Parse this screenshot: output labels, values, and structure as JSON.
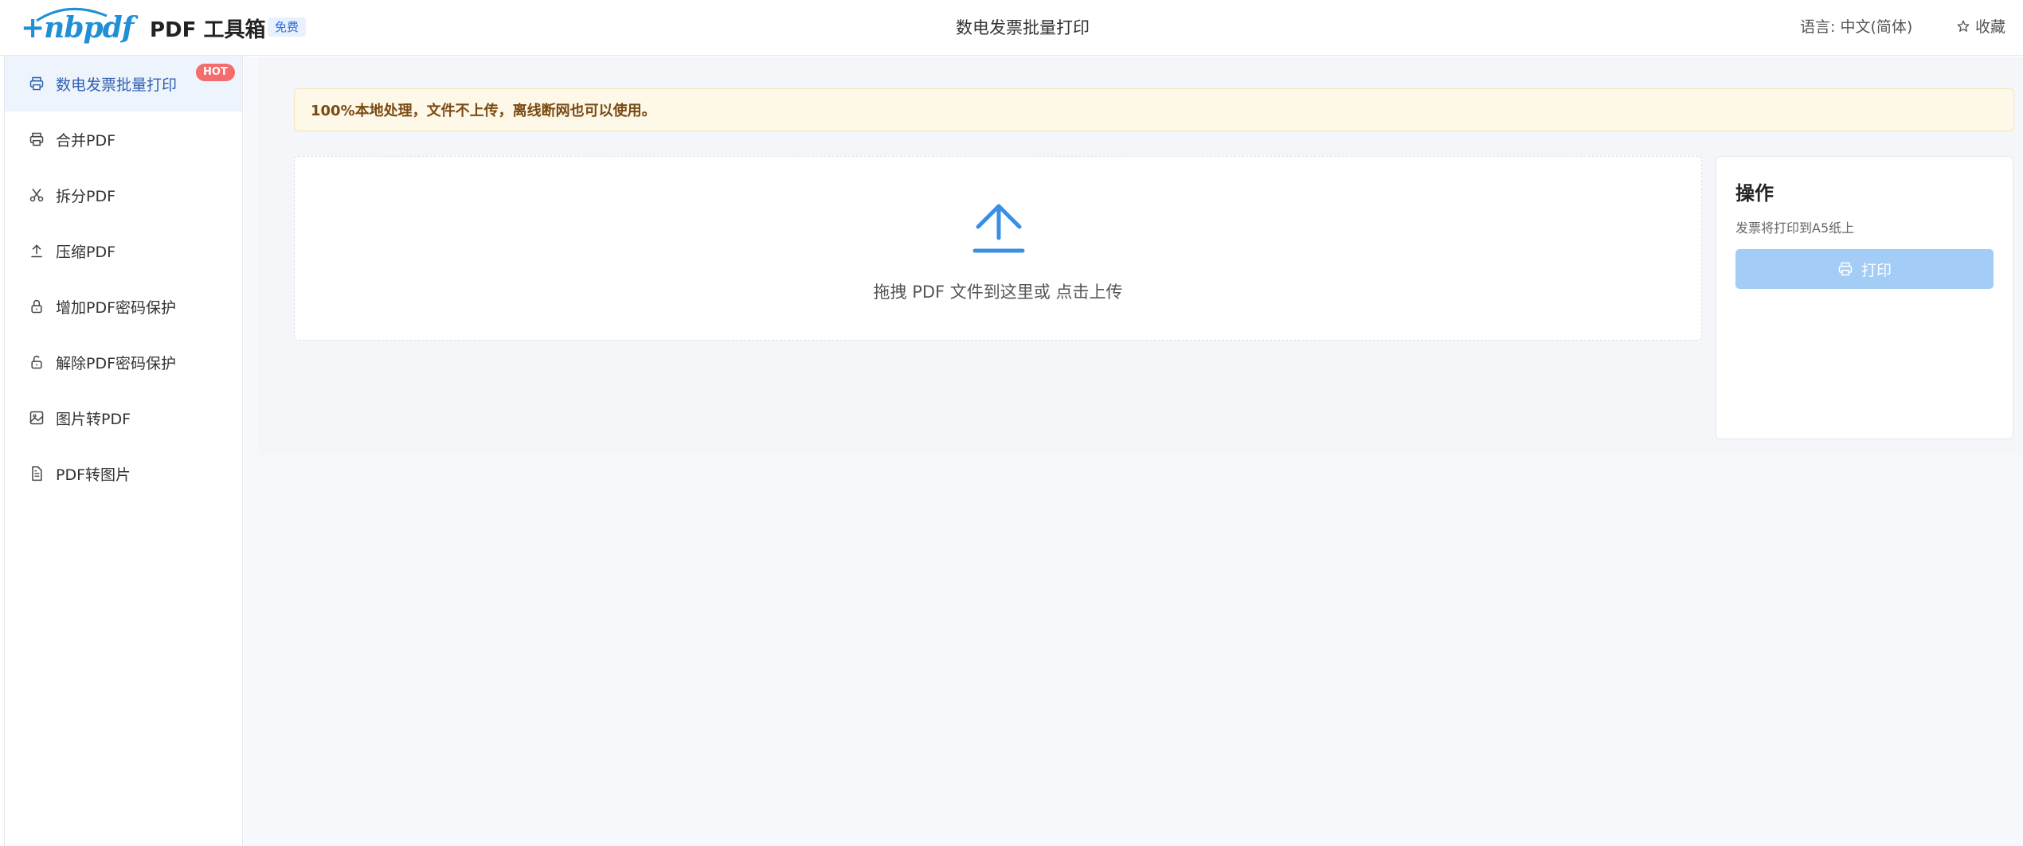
{
  "header": {
    "logo_text": "+nbpdf",
    "app_title": "PDF 工具箱",
    "free_badge": "免费",
    "page_title": "数电发票批量打印",
    "language": "语言: 中文(简体)",
    "favorite": "收藏"
  },
  "sidebar": {
    "items": [
      {
        "label": "数电发票批量打印",
        "icon": "printer-icon",
        "badge": "HOT",
        "active": true
      },
      {
        "label": "合并PDF",
        "icon": "printer-icon"
      },
      {
        "label": "拆分PDF",
        "icon": "scissors-icon"
      },
      {
        "label": "压缩PDF",
        "icon": "upload-arrow-icon"
      },
      {
        "label": "增加PDF密码保护",
        "icon": "lock-icon"
      },
      {
        "label": "解除PDF密码保护",
        "icon": "unlock-icon"
      },
      {
        "label": "图片转PDF",
        "icon": "image-icon"
      },
      {
        "label": "PDF转图片",
        "icon": "document-icon"
      }
    ]
  },
  "main": {
    "notice": "100%本地处理，文件不上传，离线断网也可以使用。",
    "dropzone_text": "拖拽 PDF 文件到这里或 点击上传",
    "ops": {
      "title": "操作",
      "description": "发票将打印到A5纸上",
      "print_label": "打印"
    }
  },
  "colors": {
    "accent": "#2f5fb3",
    "upload_icon": "#3a8ee6",
    "print_button": "#a3cdf7",
    "hot_badge": "#f56c6c",
    "notice_bg": "#fdf8e7"
  }
}
